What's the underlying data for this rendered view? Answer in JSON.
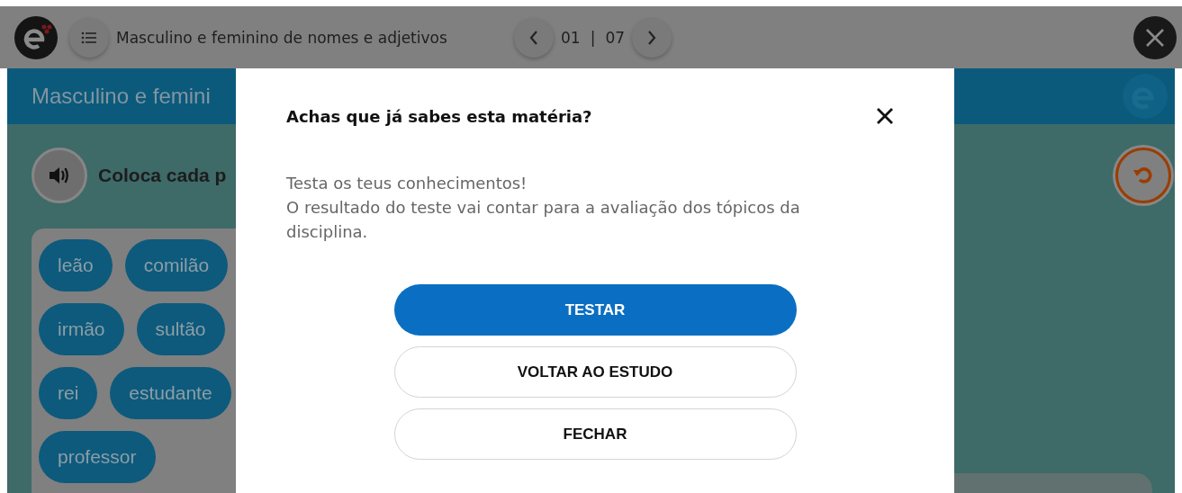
{
  "topbar": {
    "title": "Masculino e feminino de nomes e adjetivos",
    "page": {
      "current": "01",
      "separator": "|",
      "total": "07"
    }
  },
  "lesson": {
    "title": "Masculino e femini",
    "instruction": "Coloca cada p",
    "word_rows": [
      [
        "leão",
        "comilão"
      ],
      [
        "irmão",
        "sultão"
      ],
      [
        "rei",
        "estudante"
      ],
      [
        "professor"
      ]
    ]
  },
  "dialog": {
    "title": "Achas que já sabes esta matéria?",
    "message": [
      "Testa os teus conhecimentos!",
      "O resultado do teste vai contar para a avaliação dos tópicos da disciplina."
    ],
    "buttons": [
      {
        "label": "TESTAR",
        "kind": "primary"
      },
      {
        "label": "VOLTAR AO ESTUDO",
        "kind": "secondary"
      },
      {
        "label": "FECHAR",
        "kind": "secondary"
      }
    ]
  }
}
